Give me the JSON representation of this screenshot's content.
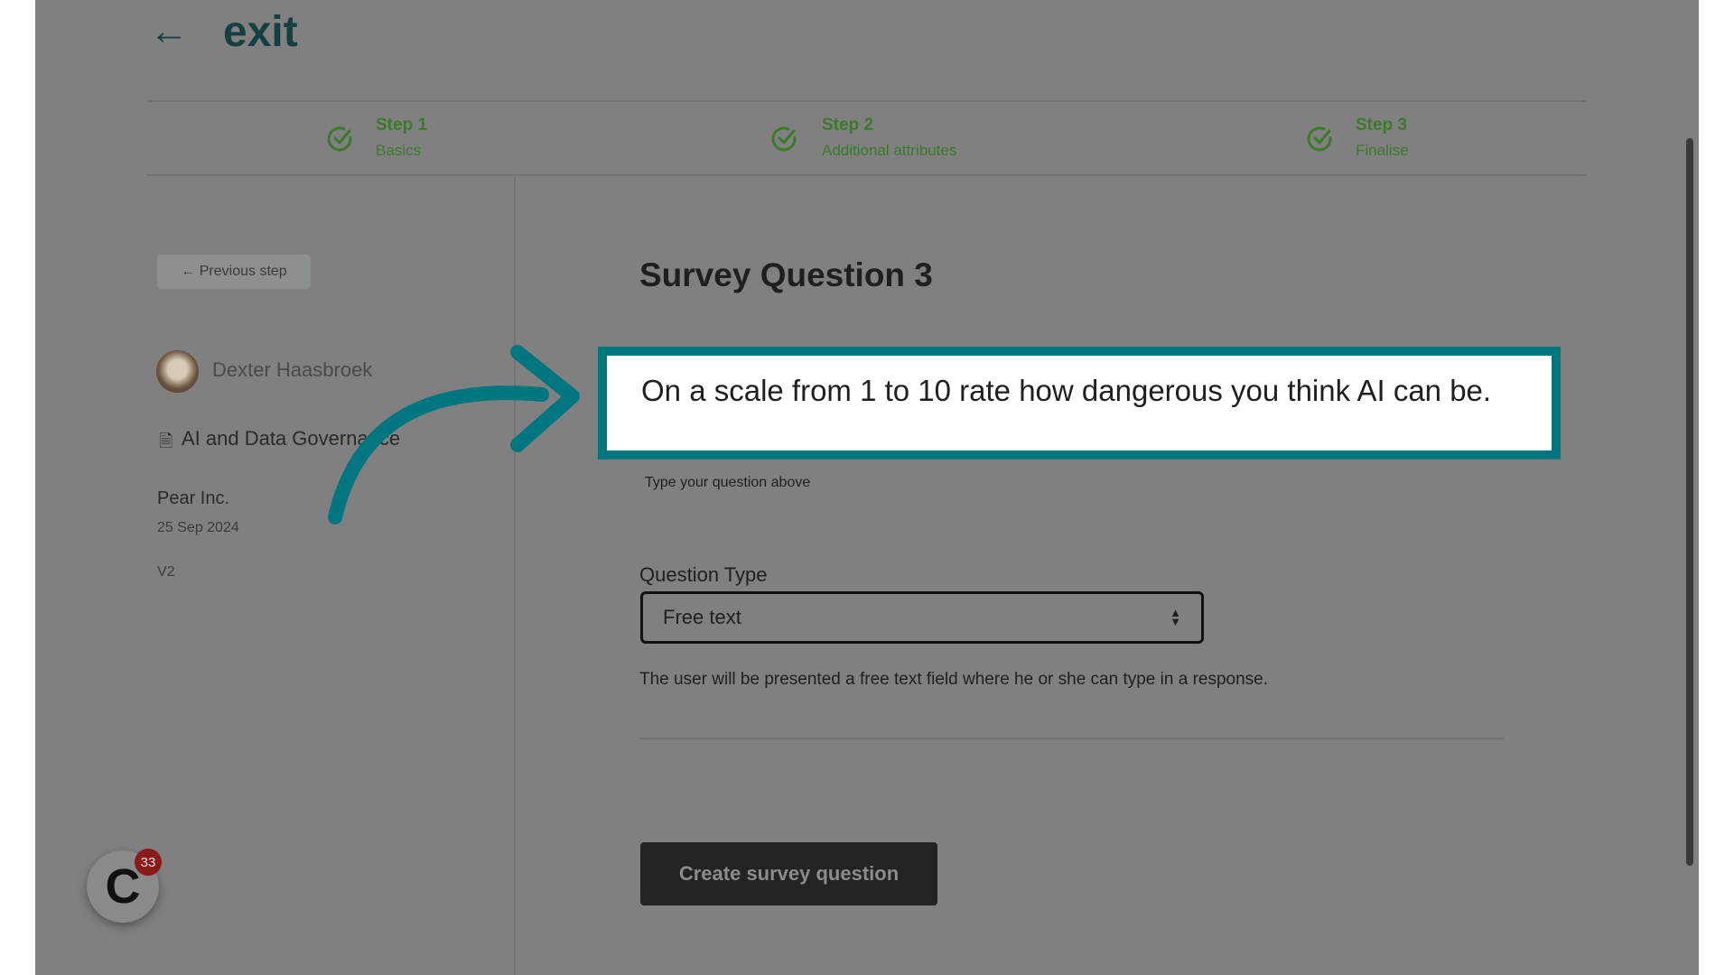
{
  "header": {
    "back_icon": "arrow-left-icon",
    "exit_label": "exit"
  },
  "steps": [
    {
      "title": "Step 1",
      "subtitle": "Basics",
      "status": "complete"
    },
    {
      "title": "Step 2",
      "subtitle": "Additional attributes",
      "status": "complete"
    },
    {
      "title": "Step 3",
      "subtitle": "Finalise",
      "status": "complete"
    }
  ],
  "sidebar": {
    "previous_label": "← Previous step",
    "user_name": "Dexter Haasbroek",
    "document_title": "AI and Data Governance",
    "company": "Pear Inc.",
    "date": "25 Sep 2024",
    "version": "V2"
  },
  "main": {
    "title": "Survey Question 3",
    "question_value": "On a scale from 1 to 10 rate how dangerous you think AI can be.",
    "question_hint": "Type your question above",
    "question_type_label": "Question Type",
    "question_type_value": "Free text",
    "question_type_description": "The user will be presented a free text field where he or she can type in a response.",
    "create_label": "Create survey question"
  },
  "widget": {
    "badge_count": "33"
  },
  "colors": {
    "highlight": "#007681",
    "step_green": "#3b7a2a",
    "overlay": "#808080"
  }
}
